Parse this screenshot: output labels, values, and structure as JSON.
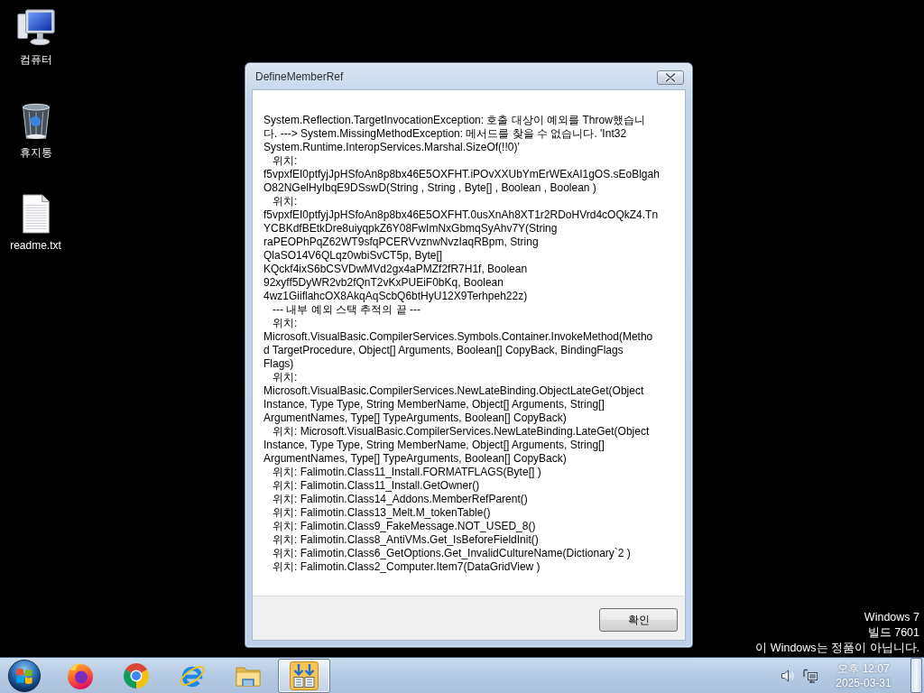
{
  "desktop_icons": [
    {
      "kind": "computer",
      "label": "컴퓨터"
    },
    {
      "kind": "recycle-bin",
      "label": "휴지통"
    },
    {
      "kind": "text-file",
      "label": "readme.txt"
    }
  ],
  "dialog": {
    "title": "DefineMemberRef",
    "message_lines": [
      "System.Reflection.TargetInvocationException: 호출 대상이 예외를 Throw했습니",
      "다. ---> System.MissingMethodException: 메서드를 찾을 수 없습니다. 'Int32",
      "System.Runtime.InteropServices.Marshal.SizeOf(!!0)'",
      "   위치:",
      "f5vpxfEI0ptfyjJpHSfoAn8p8bx46E5OXFHT.iPOvXXUbYmErWExAI1gOS.sEoBlgah",
      "O82NGelHyIbqE9DSswD(String , String , Byte[] , Boolean , Boolean )",
      "   위치:",
      "f5vpxfEI0ptfyjJpHSfoAn8p8bx46E5OXFHT.0usXnAh8XT1r2RDoHVrd4cOQkZ4.Tn",
      "YCBKdfBEtkDre8uiyqpkZ6Y08FwImNxGbmqSyAhv7Y(String",
      "raPEOPhPqZ62WT9sfqPCERVvznwNvzIaqRBpm, String",
      "QlaSO14V6QLqz0wbiSvCT5p, Byte[]",
      "KQckf4ixS6bCSVDwMVd2gx4aPMZf2fR7H1f, Boolean",
      "92xyff5DyWR2vb2fQnT2vKxPUEiF0bKq, Boolean",
      "4wz1GiiflahcOX8AkqAqScbQ6btHyU12X9Terhpeh22z)",
      "   --- 내부 예외 스택 추적의 끝 ---",
      "   위치:",
      "Microsoft.VisualBasic.CompilerServices.Symbols.Container.InvokeMethod(Metho",
      "d TargetProcedure, Object[] Arguments, Boolean[] CopyBack, BindingFlags",
      "Flags)",
      "   위치:",
      "Microsoft.VisualBasic.CompilerServices.NewLateBinding.ObjectLateGet(Object",
      "Instance, Type Type, String MemberName, Object[] Arguments, String[]",
      "ArgumentNames, Type[] TypeArguments, Boolean[] CopyBack)",
      "   위치: Microsoft.VisualBasic.CompilerServices.NewLateBinding.LateGet(Object",
      "Instance, Type Type, String MemberName, Object[] Arguments, String[]",
      "ArgumentNames, Type[] TypeArguments, Boolean[] CopyBack)",
      "   위치: Falimotin.Class11_Install.FORMATFLAGS(Byte[] )",
      "   위치: Falimotin.Class11_Install.GetOwner()",
      "   위치: Falimotin.Class14_Addons.MemberRefParent()",
      "   위치: Falimotin.Class13_Melt.M_tokenTable()",
      "   위치: Falimotin.Class9_FakeMessage.NOT_USED_8()",
      "   위치: Falimotin.Class8_AntiVMs.Get_IsBeforeFieldInit()",
      "   위치: Falimotin.Class6_GetOptions.Get_InvalidCultureName(Dictionary`2 )",
      "   위치: Falimotin.Class2_Computer.Item7(DataGridView )"
    ],
    "buttons": [
      "확인"
    ]
  },
  "activation_notice": [
    "Windows 7",
    "빌드 7601",
    "이 Windows는 정품이 아닙니다."
  ],
  "taskbar": {
    "apps": [
      {
        "kind": "firefox",
        "active": false
      },
      {
        "kind": "chrome",
        "active": false
      },
      {
        "kind": "ie",
        "active": false
      },
      {
        "kind": "folder",
        "active": false
      },
      {
        "kind": "arrows-box",
        "active": true
      }
    ],
    "clock": {
      "time": "오후 12:07",
      "date": "2025-03-31"
    }
  }
}
